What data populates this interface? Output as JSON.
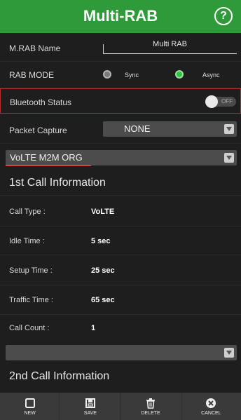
{
  "header": {
    "title": "Multi-RAB",
    "help_glyph": "?"
  },
  "settings": {
    "mrab_name_label": "M.RAB Name",
    "mrab_name_value": "Multi RAB",
    "rab_mode_label": "RAB MODE",
    "rab_mode_options": [
      "Sync",
      "Async"
    ],
    "rab_mode_selected": "Async",
    "bluetooth_label": "Bluetooth Status",
    "bluetooth_toggle": "OFF",
    "packet_capture_label": "Packet Capture",
    "packet_capture_value": "NONE"
  },
  "profile": {
    "selected": "VoLTE M2M ORG"
  },
  "call1": {
    "title": "1st Call Information",
    "rows": [
      {
        "label": "Call Type :",
        "value": "VoLTE"
      },
      {
        "label": "Idle Time :",
        "value": "5 sec"
      },
      {
        "label": "Setup Time :",
        "value": "25 sec"
      },
      {
        "label": "Traffic Time :",
        "value": "65 sec"
      },
      {
        "label": "Call Count :",
        "value": "1"
      }
    ]
  },
  "call2": {
    "title": "2nd Call Information",
    "dropdown_value": ""
  },
  "toolbar": {
    "new": "NEW",
    "save": "SAVE",
    "delete": "DELETE",
    "cancel": "CANCEL"
  },
  "colors": {
    "accent": "#2f9a3a",
    "highlight_border": "#b42f2f"
  }
}
